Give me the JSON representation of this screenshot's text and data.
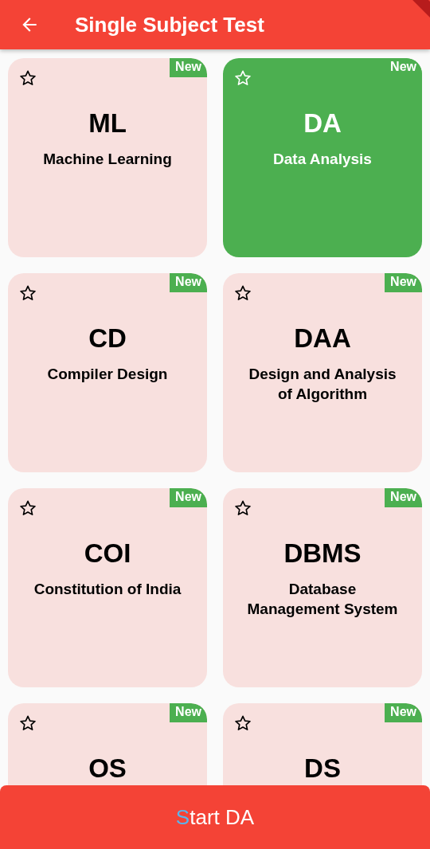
{
  "app_bar": {
    "title": "Single Subject Test"
  },
  "cards": [
    {
      "abbr": "ML",
      "name": "Machine Learning",
      "badge": "New",
      "selected": false
    },
    {
      "abbr": "DA",
      "name": "Data Analysis",
      "badge": "New",
      "selected": true
    },
    {
      "abbr": "CD",
      "name": "Compiler Design",
      "badge": "New",
      "selected": false
    },
    {
      "abbr": "DAA",
      "name": "Design and Analysis of Algorithm",
      "badge": "New",
      "selected": false
    },
    {
      "abbr": "COI",
      "name": "Constitution of India",
      "badge": "New",
      "selected": false
    },
    {
      "abbr": "DBMS",
      "name": "Database Management System",
      "badge": "New",
      "selected": false
    },
    {
      "abbr": "OS",
      "badge": "New",
      "selected": false
    },
    {
      "abbr": "DS",
      "badge": "New",
      "selected": false
    }
  ],
  "start_button": {
    "label": "Start DA"
  }
}
